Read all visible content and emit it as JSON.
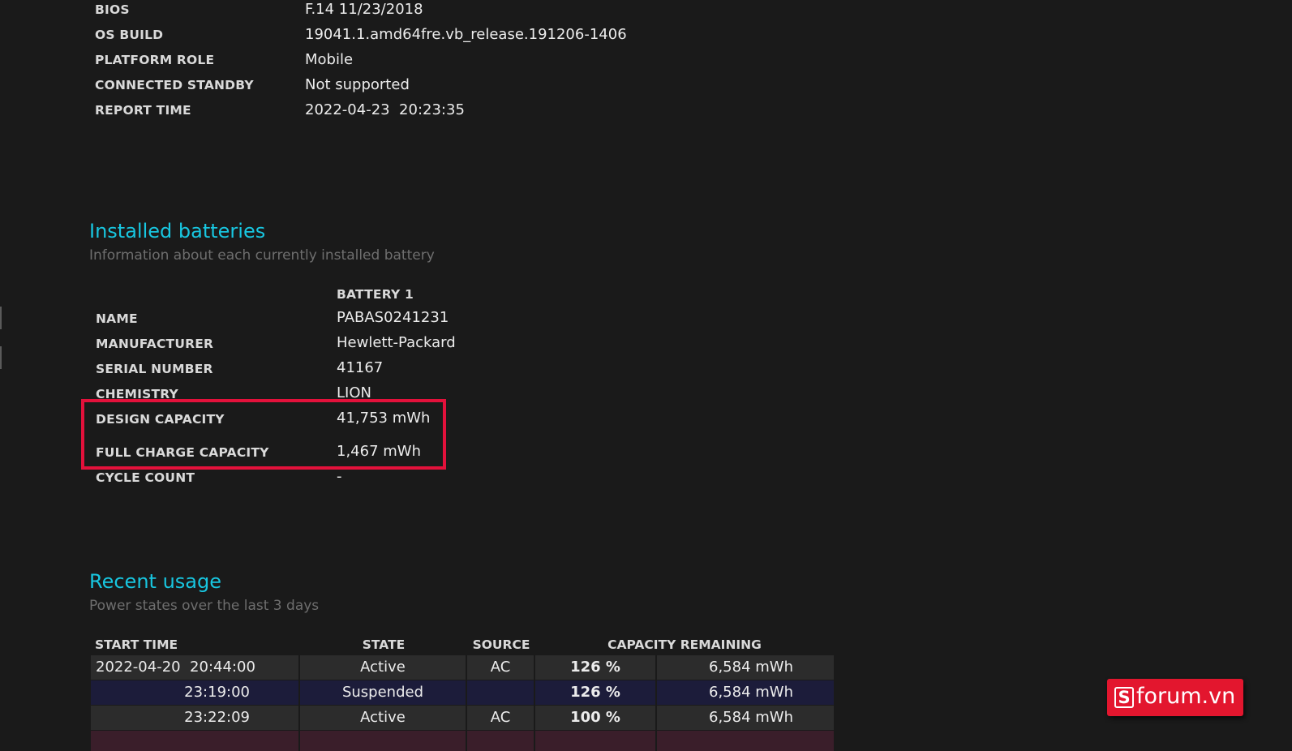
{
  "system_info": [
    {
      "key": "BIOS",
      "value": "F.14 11/23/2018"
    },
    {
      "key": "OS BUILD",
      "value": "19041.1.amd64fre.vb_release.191206-1406"
    },
    {
      "key": "PLATFORM ROLE",
      "value": "Mobile"
    },
    {
      "key": "CONNECTED STANDBY",
      "value": "Not supported"
    },
    {
      "key": "REPORT TIME",
      "value": "2022-04-23  20:23:35"
    }
  ],
  "installed_batteries": {
    "title": "Installed batteries",
    "subtitle": "Information about each currently installed battery",
    "column_header": "BATTERY 1",
    "rows": [
      {
        "key": "NAME",
        "value": "PABAS0241231"
      },
      {
        "key": "MANUFACTURER",
        "value": "Hewlett-Packard"
      },
      {
        "key": "SERIAL NUMBER",
        "value": "41167"
      },
      {
        "key": "CHEMISTRY",
        "value": "LION"
      },
      {
        "key": "DESIGN CAPACITY",
        "value": "41,753 mWh"
      },
      {
        "key": "FULL CHARGE CAPACITY",
        "value": "1,467 mWh"
      },
      {
        "key": "CYCLE COUNT",
        "value": "-"
      }
    ]
  },
  "recent_usage": {
    "title": "Recent usage",
    "subtitle": "Power states over the last 3 days",
    "headers": {
      "start_time": "START TIME",
      "state": "STATE",
      "source": "SOURCE",
      "capacity_remaining": "CAPACITY REMAINING"
    },
    "rows": [
      {
        "start_time": "2022-04-20  20:44:00",
        "state": "Active",
        "source": "AC",
        "percent": "126 %",
        "mwh": "6,584 mWh"
      },
      {
        "start_time": "23:19:00",
        "state": "Suspended",
        "source": "",
        "percent": "126 %",
        "mwh": "6,584 mWh"
      },
      {
        "start_time": "23:22:09",
        "state": "Active",
        "source": "AC",
        "percent": "100 %",
        "mwh": "6,584 mWh"
      }
    ]
  },
  "watermark": {
    "logo_letter": "S",
    "text": "forum.vn"
  },
  "colors": {
    "background": "#1a1a1a",
    "heading": "#18c6e0",
    "highlight_box": "#e3113b",
    "logo_bg": "#e3162e"
  }
}
